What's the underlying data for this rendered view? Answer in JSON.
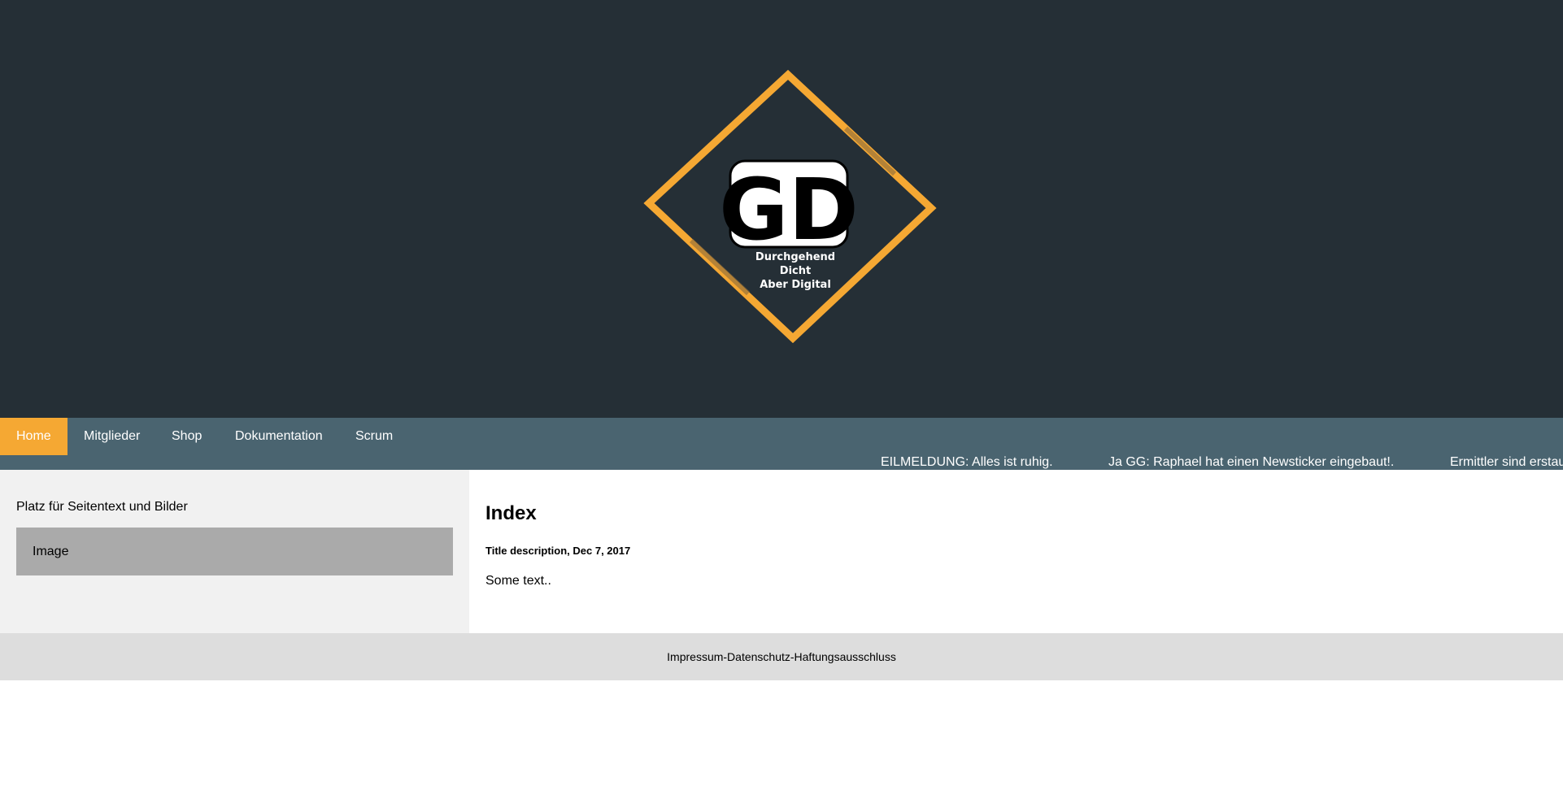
{
  "header": {
    "logo": {
      "monogram": "GD",
      "tagline_lines": [
        "Durchgehend",
        "Dicht",
        "Aber Digital"
      ]
    }
  },
  "nav": {
    "items": [
      {
        "label": "Home",
        "active": true
      },
      {
        "label": "Mitglieder",
        "active": false
      },
      {
        "label": "Shop",
        "active": false
      },
      {
        "label": "Dokumentation",
        "active": false
      },
      {
        "label": "Scrum",
        "active": false
      }
    ]
  },
  "ticker": {
    "items": [
      "EILMELDUNG: Alles ist ruhig.",
      "Ja GG: Raphael hat einen Newsticker eingebaut!.",
      "Ermittler sind erstau"
    ]
  },
  "sidebar": {
    "text": "Platz für Seitentext und Bilder",
    "image_label": "Image"
  },
  "main": {
    "title": "Index",
    "description": "Title description, Dec 7, 2017",
    "text": "Some text.."
  },
  "footer": {
    "text": "Impressum-Datenschutz-Haftungsausschluss"
  },
  "colors": {
    "header_bg": "#252f36",
    "nav_bg": "#4a6470",
    "accent": "#f5a833",
    "sidebar_bg": "#f1f1f1",
    "image_bg": "#aaaaaa",
    "footer_bg": "#dddddd"
  }
}
